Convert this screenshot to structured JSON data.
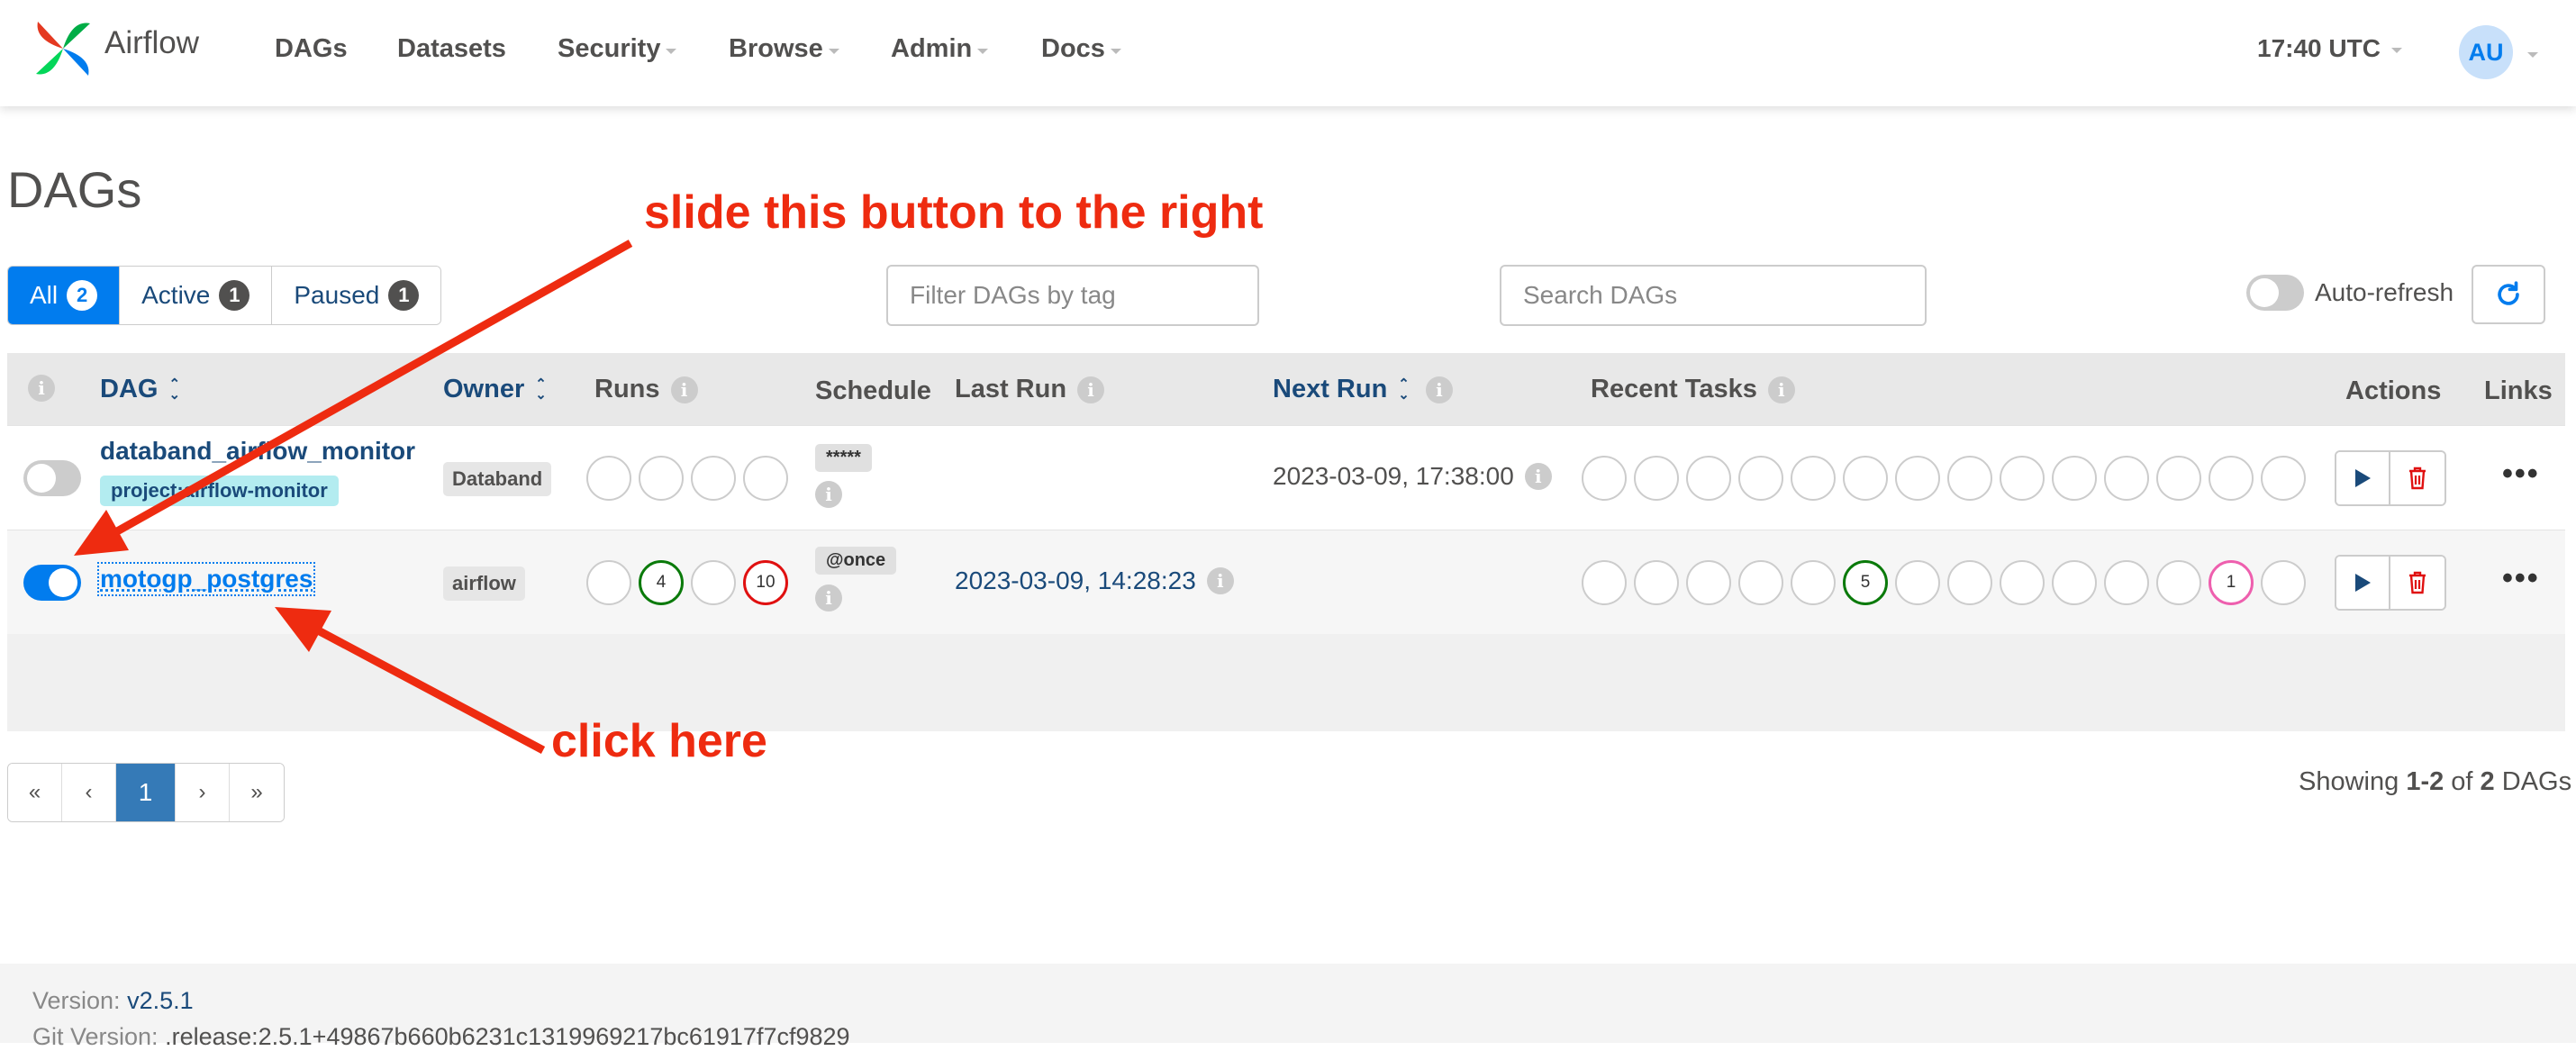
{
  "nav": {
    "brand": "Airflow",
    "items": [
      "DAGs",
      "Datasets",
      "Security",
      "Browse",
      "Admin",
      "Docs"
    ],
    "time": "17:40 UTC",
    "avatar": "AU"
  },
  "page": {
    "title": "DAGs"
  },
  "filters": {
    "tabs": [
      {
        "label": "All",
        "count": "2"
      },
      {
        "label": "Active",
        "count": "1"
      },
      {
        "label": "Paused",
        "count": "1"
      }
    ],
    "tag_placeholder": "Filter DAGs by tag",
    "search_placeholder": "Search DAGs",
    "autorefresh_label": "Auto-refresh"
  },
  "table": {
    "headers": {
      "dag": "DAG",
      "owner": "Owner",
      "runs": "Runs",
      "schedule": "Schedule",
      "last_run": "Last Run",
      "next_run": "Next Run",
      "recent_tasks": "Recent Tasks",
      "actions": "Actions",
      "links": "Links"
    },
    "rows": [
      {
        "name": "databand_airflow_monitor",
        "tag": "project:airflow-monitor",
        "owner": "Databand",
        "runs": [
          "",
          "",
          "",
          ""
        ],
        "schedule": "*****",
        "last_run": "",
        "next_run": "2023-03-09, 17:38:00",
        "paused": true,
        "recent_tasks": [
          "",
          "",
          "",
          "",
          "",
          "",
          "",
          "",
          "",
          "",
          "",
          "",
          "",
          ""
        ]
      },
      {
        "name": "motogp_postgres",
        "owner": "airflow",
        "runs": [
          "",
          "4",
          "",
          "10"
        ],
        "schedule": "@once",
        "last_run": "2023-03-09, 14:28:23",
        "next_run": "",
        "paused": false,
        "recent_tasks": [
          "",
          "",
          "",
          "",
          "",
          "5",
          "",
          "",
          "",
          "",
          "",
          "",
          "1",
          ""
        ]
      }
    ]
  },
  "pagination": {
    "first": "«",
    "prev": "‹",
    "current": "1",
    "next": "›",
    "last": "»"
  },
  "showing": {
    "prefix": "Showing ",
    "range": "1-2",
    "of": " of ",
    "total": "2",
    "suffix": " DAGs"
  },
  "footer": {
    "version_label": "Version: ",
    "version": "v2.5.1",
    "git_label": "Git Version: ",
    "git": ".release:2.5.1+49867b660b6231c1319969217bc61917f7cf9829"
  },
  "annotations": {
    "slide": "slide this button to the right",
    "click": "click here"
  },
  "colors": {
    "accent": "#017cee",
    "annotation": "#ee2b10",
    "success": "#0a7a0a",
    "failed": "#e01010",
    "up_for_retry": "#ee5fae"
  }
}
